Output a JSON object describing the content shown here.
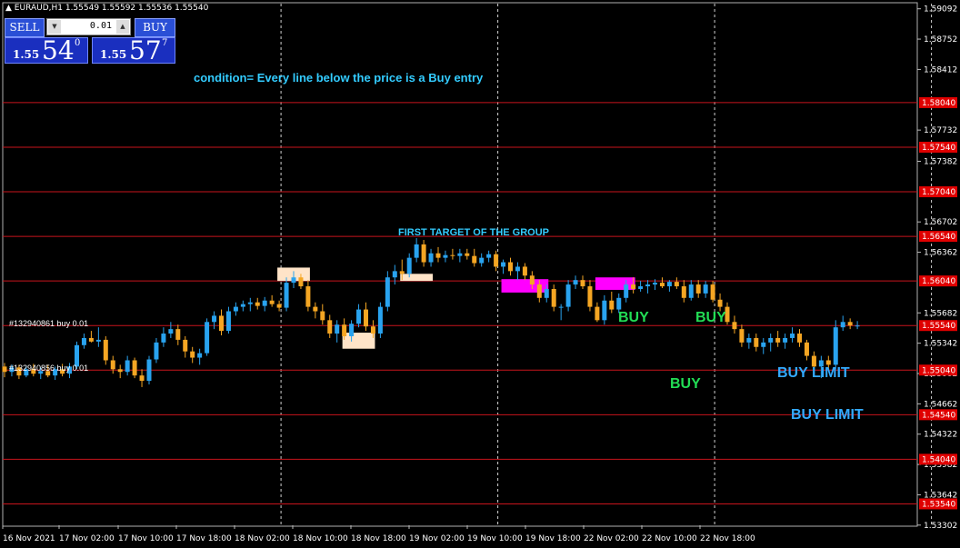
{
  "window_title": "EURAUD,H1  1.55549 1.55592 1.55536 1.55540",
  "trade_panel": {
    "sell_label": "SELL",
    "buy_label": "BUY",
    "lot": "0.01",
    "bid_prefix": "1.55",
    "bid_big": "54",
    "bid_sup": "0",
    "ask_prefix": "1.55",
    "ask_big": "57",
    "ask_sup": "7"
  },
  "annotations": {
    "condition": "condition= Every line below the price is a Buy entry",
    "first_target": "FIRST TARGET OF THE GROUP",
    "buy_1": "BUY",
    "buy_2": "BUY",
    "buy_3": "BUY",
    "buy_limit_1": "BUY LIMIT",
    "buy_limit_2": "BUY LIMIT",
    "order_1": "#132940861 buy 0.01",
    "order_2": "#132940856 buy 0.01"
  },
  "colors": {
    "background": "#000000",
    "bull": "#29a3ef",
    "bear": "#f5a623",
    "level_line": "#c8141c",
    "level_tag": "#e00000",
    "cyan_text": "#33ccff",
    "green_text": "#22dd55",
    "magenta_zone": "#ff00ff",
    "peach_zone": "#ffe4c8"
  },
  "chart_data": {
    "type": "candlestick",
    "symbol": "EURAUD",
    "timeframe": "H1",
    "ylim": [
      1.533,
      1.5915
    ],
    "y_ticks": [
      "1.59092",
      "1.58752",
      "1.58412",
      "1.57732",
      "1.57382",
      "1.56702",
      "1.56362",
      "1.55682",
      "1.55342",
      "1.55002",
      "1.54662",
      "1.54322",
      "1.53982",
      "1.53642",
      "1.53302"
    ],
    "level_lines": [
      "1.58040",
      "1.57540",
      "1.57040",
      "1.56540",
      "1.56040",
      "1.55540",
      "1.55040",
      "1.54540",
      "1.54040",
      "1.53540"
    ],
    "x_labels": [
      "16 Nov 2021",
      "17 Nov 02:00",
      "17 Nov 10:00",
      "17 Nov 18:00",
      "18 Nov 02:00",
      "18 Nov 10:00",
      "18 Nov 18:00",
      "19 Nov 02:00",
      "19 Nov 10:00",
      "19 Nov 18:00",
      "22 Nov 02:00",
      "22 Nov 10:00",
      "22 Nov 18:00"
    ],
    "bar_count": 127,
    "separator_bars": [
      38,
      68,
      98,
      128
    ],
    "candles_ohlc": [
      [
        1.5508,
        1.5512,
        1.5496,
        1.5502
      ],
      [
        1.5502,
        1.551,
        1.5497,
        1.5507
      ],
      [
        1.5507,
        1.551,
        1.5494,
        1.5498
      ],
      [
        1.5498,
        1.5509,
        1.5496,
        1.5505
      ],
      [
        1.5505,
        1.5511,
        1.5497,
        1.55
      ],
      [
        1.55,
        1.5507,
        1.5494,
        1.5503
      ],
      [
        1.5503,
        1.551,
        1.5496,
        1.5498
      ],
      [
        1.5498,
        1.5508,
        1.5493,
        1.5505
      ],
      [
        1.5505,
        1.5511,
        1.5497,
        1.55
      ],
      [
        1.55,
        1.5512,
        1.5495,
        1.5508
      ],
      [
        1.5508,
        1.5536,
        1.5505,
        1.5532
      ],
      [
        1.5532,
        1.5545,
        1.5528,
        1.554
      ],
      [
        1.554,
        1.5548,
        1.5535,
        1.5536
      ],
      [
        1.5536,
        1.5552,
        1.553,
        1.5538
      ],
      [
        1.5538,
        1.5542,
        1.551,
        1.5515
      ],
      [
        1.5515,
        1.552,
        1.55,
        1.5505
      ],
      [
        1.5505,
        1.551,
        1.5495,
        1.5502
      ],
      [
        1.5502,
        1.552,
        1.5498,
        1.5515
      ],
      [
        1.5515,
        1.5518,
        1.5495,
        1.5498
      ],
      [
        1.5498,
        1.5505,
        1.5485,
        1.5492
      ],
      [
        1.5492,
        1.552,
        1.5488,
        1.5516
      ],
      [
        1.5516,
        1.554,
        1.5512,
        1.5535
      ],
      [
        1.5535,
        1.5552,
        1.553,
        1.5545
      ],
      [
        1.5545,
        1.5558,
        1.554,
        1.555
      ],
      [
        1.555,
        1.5555,
        1.5532,
        1.5538
      ],
      [
        1.5538,
        1.5542,
        1.5518,
        1.5525
      ],
      [
        1.5525,
        1.553,
        1.5512,
        1.5518
      ],
      [
        1.5518,
        1.5528,
        1.551,
        1.5523
      ],
      [
        1.5523,
        1.5562,
        1.552,
        1.5558
      ],
      [
        1.5558,
        1.557,
        1.555,
        1.5565
      ],
      [
        1.5565,
        1.5572,
        1.5543,
        1.5548
      ],
      [
        1.5548,
        1.5575,
        1.5545,
        1.557
      ],
      [
        1.557,
        1.558,
        1.5565,
        1.5575
      ],
      [
        1.5575,
        1.5582,
        1.557,
        1.5578
      ],
      [
        1.5578,
        1.5585,
        1.557,
        1.558
      ],
      [
        1.558,
        1.5585,
        1.5572,
        1.5576
      ],
      [
        1.5576,
        1.5586,
        1.557,
        1.5582
      ],
      [
        1.5582,
        1.5588,
        1.5575,
        1.5578
      ],
      [
        1.5578,
        1.5582,
        1.557,
        1.5574
      ],
      [
        1.5574,
        1.5608,
        1.557,
        1.5602
      ],
      [
        1.5602,
        1.5615,
        1.5596,
        1.5608
      ],
      [
        1.5608,
        1.5612,
        1.5595,
        1.5598
      ],
      [
        1.5598,
        1.5605,
        1.557,
        1.5575
      ],
      [
        1.5575,
        1.558,
        1.5562,
        1.557
      ],
      [
        1.557,
        1.5578,
        1.5555,
        1.556
      ],
      [
        1.556,
        1.5566,
        1.554,
        1.5545
      ],
      [
        1.5545,
        1.556,
        1.5535,
        1.5555
      ],
      [
        1.5555,
        1.5562,
        1.5538,
        1.5542
      ],
      [
        1.5542,
        1.556,
        1.5536,
        1.5556
      ],
      [
        1.5556,
        1.5578,
        1.5552,
        1.5572
      ],
      [
        1.5572,
        1.558,
        1.5548,
        1.5553
      ],
      [
        1.5553,
        1.556,
        1.554,
        1.5545
      ],
      [
        1.5545,
        1.558,
        1.554,
        1.5575
      ],
      [
        1.5575,
        1.5615,
        1.557,
        1.5608
      ],
      [
        1.5608,
        1.5622,
        1.56,
        1.5615
      ],
      [
        1.5615,
        1.5628,
        1.5605,
        1.5612
      ],
      [
        1.5612,
        1.5635,
        1.5608,
        1.563
      ],
      [
        1.563,
        1.5652,
        1.5625,
        1.5645
      ],
      [
        1.5645,
        1.565,
        1.562,
        1.5625
      ],
      [
        1.5625,
        1.564,
        1.562,
        1.5635
      ],
      [
        1.5635,
        1.5642,
        1.5625,
        1.563
      ],
      [
        1.563,
        1.5638,
        1.5625,
        1.5633
      ],
      [
        1.5633,
        1.564,
        1.5628,
        1.5632
      ],
      [
        1.5632,
        1.564,
        1.5625,
        1.5635
      ],
      [
        1.5635,
        1.564,
        1.5628,
        1.5632
      ],
      [
        1.5632,
        1.564,
        1.562,
        1.5624
      ],
      [
        1.5624,
        1.5635,
        1.562,
        1.563
      ],
      [
        1.563,
        1.5638,
        1.5625,
        1.5634
      ],
      [
        1.5634,
        1.5638,
        1.5615,
        1.562
      ],
      [
        1.562,
        1.5628,
        1.5612,
        1.5625
      ],
      [
        1.5625,
        1.563,
        1.561,
        1.5615
      ],
      [
        1.5615,
        1.5625,
        1.5605,
        1.562
      ],
      [
        1.562,
        1.5624,
        1.5605,
        1.561
      ],
      [
        1.561,
        1.5615,
        1.5595,
        1.56
      ],
      [
        1.56,
        1.5605,
        1.558,
        1.5585
      ],
      [
        1.5585,
        1.56,
        1.558,
        1.5595
      ],
      [
        1.5595,
        1.56,
        1.557,
        1.5575
      ],
      [
        1.5575,
        1.5578,
        1.556,
        1.5575
      ],
      [
        1.5575,
        1.5605,
        1.557,
        1.56
      ],
      [
        1.56,
        1.561,
        1.5595,
        1.5605
      ],
      [
        1.5605,
        1.561,
        1.5595,
        1.5598
      ],
      [
        1.5598,
        1.5605,
        1.557,
        1.5575
      ],
      [
        1.5575,
        1.558,
        1.5558,
        1.556
      ],
      [
        1.556,
        1.5588,
        1.5555,
        1.5582
      ],
      [
        1.5582,
        1.5592,
        1.5568,
        1.5572
      ],
      [
        1.5572,
        1.559,
        1.5568,
        1.5585
      ],
      [
        1.5585,
        1.5605,
        1.558,
        1.56
      ],
      [
        1.56,
        1.5608,
        1.559,
        1.5595
      ],
      [
        1.5595,
        1.5604,
        1.5592,
        1.5598
      ],
      [
        1.5598,
        1.5605,
        1.559,
        1.56
      ],
      [
        1.56,
        1.5606,
        1.5594,
        1.5602
      ],
      [
        1.5602,
        1.5608,
        1.5596,
        1.5598
      ],
      [
        1.5598,
        1.5605,
        1.5592,
        1.5603
      ],
      [
        1.5603,
        1.5608,
        1.5595,
        1.5598
      ],
      [
        1.5598,
        1.5605,
        1.558,
        1.5585
      ],
      [
        1.5585,
        1.5605,
        1.5582,
        1.56
      ],
      [
        1.56,
        1.5605,
        1.5585,
        1.559
      ],
      [
        1.559,
        1.5604,
        1.5585,
        1.56
      ],
      [
        1.56,
        1.5604,
        1.558,
        1.5583
      ],
      [
        1.5583,
        1.559,
        1.557,
        1.5575
      ],
      [
        1.5575,
        1.558,
        1.5555,
        1.5558
      ],
      [
        1.5558,
        1.5565,
        1.5545,
        1.555
      ],
      [
        1.555,
        1.5555,
        1.553,
        1.5535
      ],
      [
        1.5535,
        1.5545,
        1.5528,
        1.554
      ],
      [
        1.554,
        1.5545,
        1.5525,
        1.553
      ],
      [
        1.553,
        1.554,
        1.5522,
        1.5535
      ],
      [
        1.5535,
        1.5545,
        1.5525,
        1.554
      ],
      [
        1.554,
        1.5548,
        1.553,
        1.5535
      ],
      [
        1.5535,
        1.5545,
        1.5528,
        1.554
      ],
      [
        1.554,
        1.5552,
        1.5535,
        1.5545
      ],
      [
        1.5545,
        1.555,
        1.553,
        1.5535
      ],
      [
        1.5535,
        1.5538,
        1.5515,
        1.552
      ],
      [
        1.552,
        1.5525,
        1.55,
        1.5508
      ],
      [
        1.5508,
        1.552,
        1.5495,
        1.5515
      ],
      [
        1.5515,
        1.552,
        1.5505,
        1.551
      ],
      [
        1.551,
        1.556,
        1.5505,
        1.5552
      ],
      [
        1.5552,
        1.5565,
        1.5548,
        1.5558
      ],
      [
        1.5558,
        1.5562,
        1.555,
        1.5554
      ],
      [
        1.5554,
        1.5559,
        1.555,
        1.5554
      ]
    ],
    "zones": [
      {
        "from_bar": 38,
        "to_bar": 42,
        "low": 1.5604,
        "high": 1.5619,
        "color": "peach"
      },
      {
        "from_bar": 47,
        "to_bar": 51,
        "low": 1.5528,
        "high": 1.5546,
        "color": "peach"
      },
      {
        "from_bar": 55,
        "to_bar": 59,
        "low": 1.5604,
        "high": 1.5612,
        "color": "peach"
      },
      {
        "from_bar": 69,
        "to_bar": 75,
        "low": 1.5591,
        "high": 1.5606,
        "color": "magenta"
      },
      {
        "from_bar": 82,
        "to_bar": 87,
        "low": 1.5594,
        "high": 1.5608,
        "color": "magenta"
      }
    ]
  }
}
